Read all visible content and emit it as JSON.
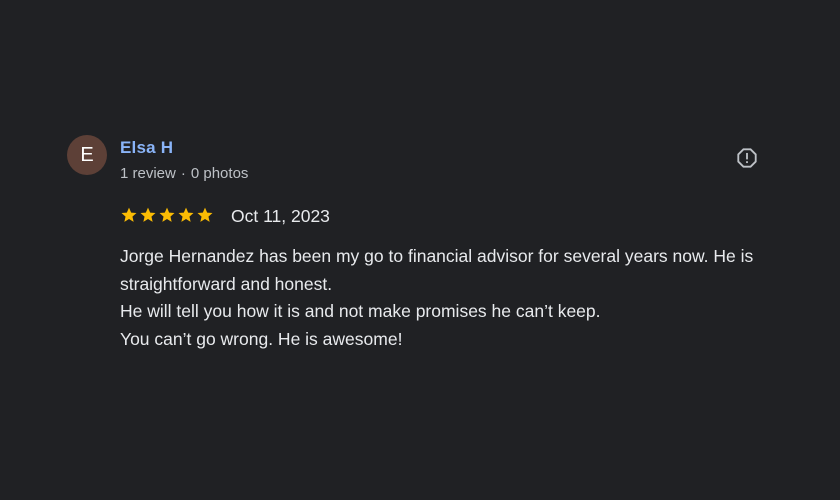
{
  "review": {
    "author": {
      "initial": "E",
      "name": "Elsa H",
      "review_count": "1 review",
      "separator": "·",
      "photo_count": "0 photos"
    },
    "rating": 5,
    "max_rating": 5,
    "date": "Oct 11, 2023",
    "text_lines": [
      "Jorge Hernandez has been my go to financial advisor for several years now. He is straightforward and honest.",
      "He will tell you how it is and not make promises he can’t keep.",
      "You can’t go wrong. He is awesome!"
    ],
    "report_icon": "report-flag-icon"
  },
  "colors": {
    "background": "#202124",
    "avatar": "#5d4037",
    "author_name": "#8ab4f8",
    "star": "#fbbc04",
    "text": "#e8eaed",
    "meta_text": "#bdc1c6",
    "icon": "#bdc1c6"
  }
}
